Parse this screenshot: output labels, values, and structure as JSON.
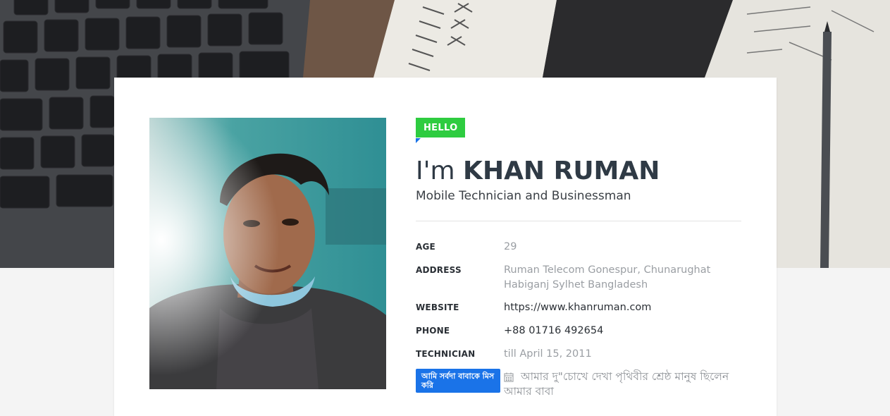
{
  "profile": {
    "hello": "HELLO",
    "name_prefix": "I'm",
    "name": "KHAN RUMAN",
    "title": "Mobile Technician and Businessman"
  },
  "details": [
    {
      "label": "AGE",
      "value": "29"
    },
    {
      "label": "ADDRESS",
      "value": "Ruman Telecom Gonespur, Chunarughat Habiganj Sylhet Bangladesh"
    },
    {
      "label": "WEBSITE",
      "value": "https://www.khanruman.com"
    },
    {
      "label": "PHONE",
      "value": "+88 01716 492654"
    },
    {
      "label": "TECHNICIAN",
      "value": "till April 15, 2011"
    }
  ],
  "badge": {
    "text": "আমি সর্বদা বাবাকে মিস করি"
  },
  "quote": {
    "icon": "calendar-icon",
    "text": "আমার দু\"চোখে দেখা পৃথিবীর শ্রেষ্ঠ মানুষ ছিলেন আমার বাবা"
  },
  "colors": {
    "hello_bg": "#2ecc40",
    "badge_bg": "#1a73e8",
    "heading": "#2f3a45",
    "muted": "#9a9ea3"
  }
}
